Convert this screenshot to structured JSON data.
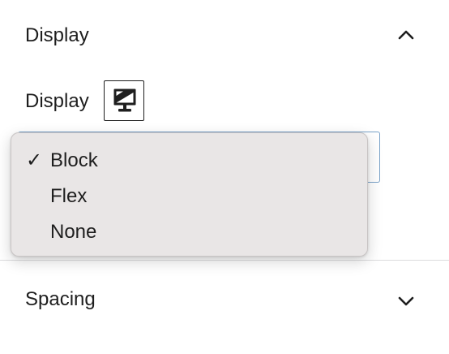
{
  "display_panel": {
    "title": "Display",
    "field_label": "Display",
    "device_icon": "desktop-icon",
    "toggle_icon": "chevron-up-icon"
  },
  "display_select": {
    "selected": "Block",
    "options": [
      {
        "label": "Block",
        "checked": true
      },
      {
        "label": "Flex",
        "checked": false
      },
      {
        "label": "None",
        "checked": false
      }
    ],
    "check_glyph": "✓"
  },
  "spacing_panel": {
    "title": "Spacing",
    "toggle_icon": "chevron-down-icon"
  }
}
